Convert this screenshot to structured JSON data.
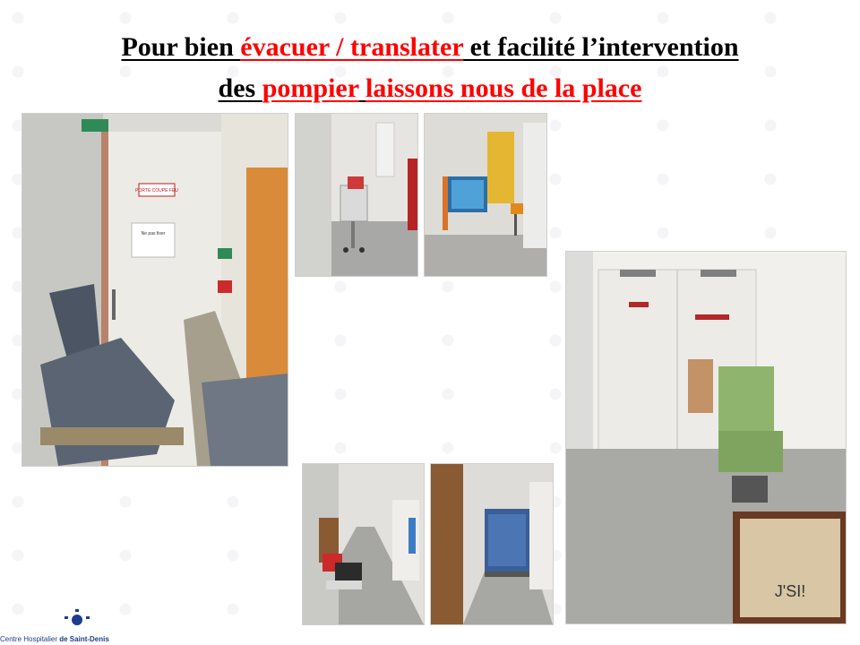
{
  "title": {
    "line1_part1": "Pour bien ",
    "line1_red": "évacuer / translater",
    "line1_part2": " et facilité l’intervention",
    "line2_part1": "des ",
    "line2_red1": "pompier",
    "line2_part2": " ",
    "line2_red2": "laissons nous de la place"
  },
  "photos": {
    "p1_sign": "PORTE COUPE FEU",
    "p1_note": "Ne pas fixer",
    "p5_graffiti": "J'SI!"
  },
  "logo": {
    "text_prefix": "Centre Hospitalier ",
    "text_name": "de Saint-Denis"
  },
  "colors": {
    "accent_red": "#ff0000",
    "logo_blue": "#1d3c8f"
  }
}
